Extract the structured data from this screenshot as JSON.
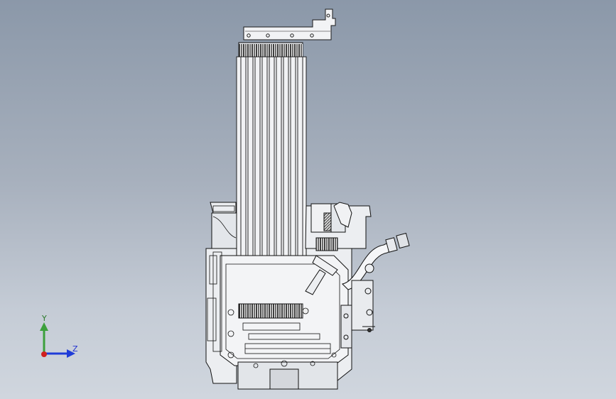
{
  "viewport": {
    "background_top": "#8b98a9",
    "background_bottom": "#d0d6de",
    "content": "engine-assembly-model"
  },
  "triad": {
    "y_label": "Y",
    "z_label": "Z",
    "y_color": "#3ca03c",
    "z_color": "#1f3cd8",
    "origin_color": "#d02020"
  }
}
